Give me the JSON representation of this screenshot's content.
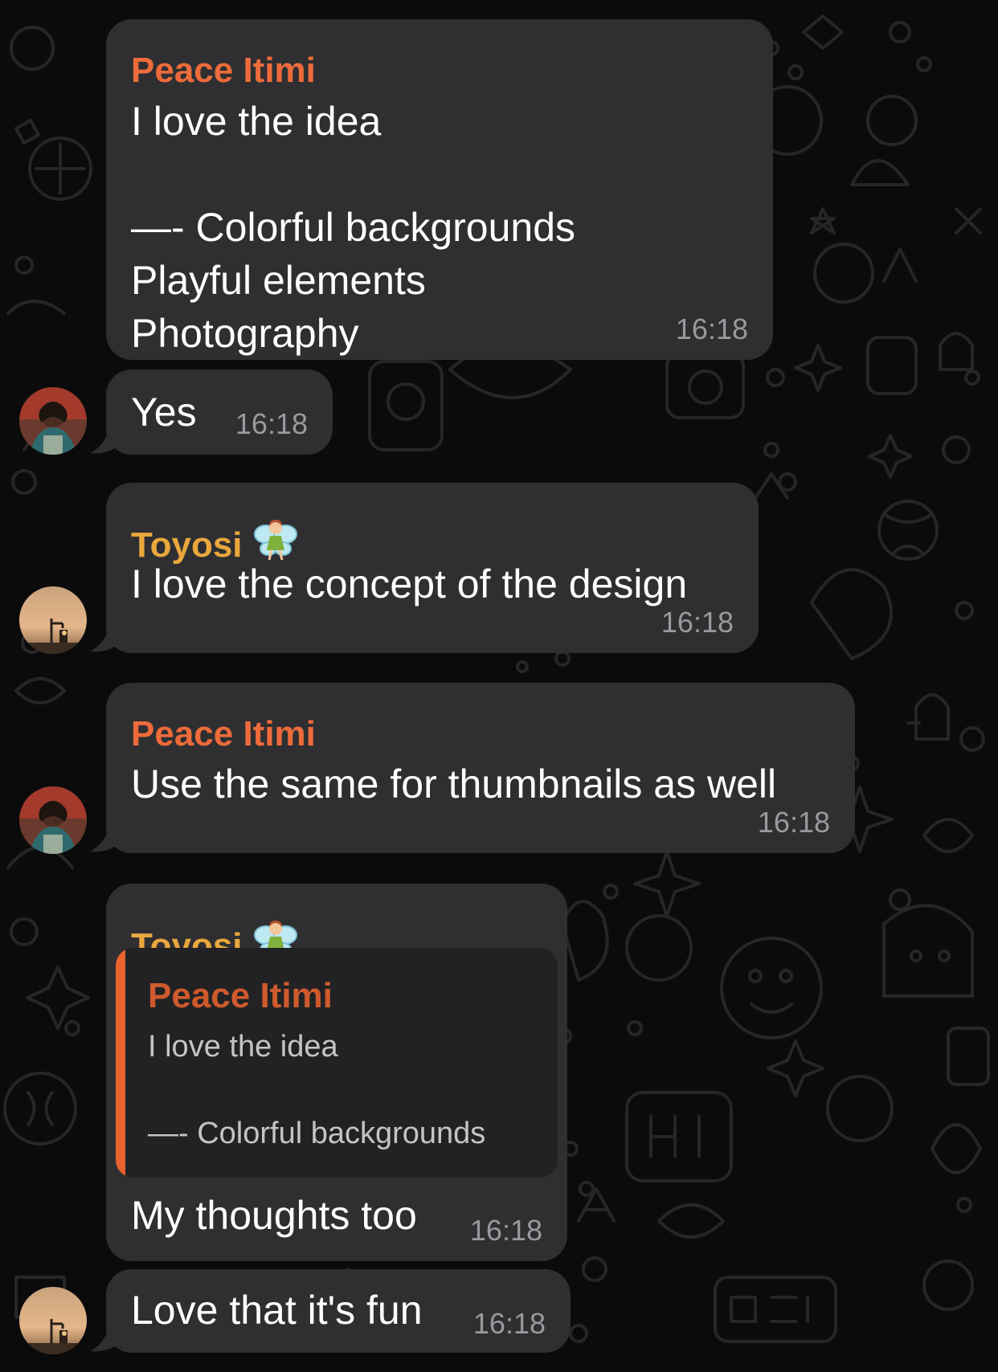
{
  "colors": {
    "background": "#0b0b0c",
    "bubble": "#2f2f31",
    "peace_name": "#ed6b3a",
    "toyosi_name": "#e9a73d",
    "quote_bar": "#e8622f",
    "timestamp": "#9a9a9e"
  },
  "messages": [
    {
      "sender": "Peace Itimi",
      "text": "I love the idea\n\n—- Colorful backgrounds\nPlayful elements\nPhotography",
      "time": "16:18"
    },
    {
      "text": "Yes",
      "time": "16:18",
      "avatar_icon": "peace-avatar-icon"
    },
    {
      "sender": "Toyosi",
      "sender_emoji": "fairy-emoji-icon",
      "text": "I love the concept of the design",
      "time": "16:18",
      "avatar_icon": "toyosi-avatar-icon"
    },
    {
      "sender": "Peace Itimi",
      "text": "Use the same for thumbnails as well",
      "time": "16:18",
      "avatar_icon": "peace-avatar-icon"
    },
    {
      "sender": "Toyosi",
      "sender_emoji": "fairy-emoji-icon",
      "quote": {
        "sender": "Peace Itimi",
        "text": "I love the idea\n\n—- Colorful backgrounds"
      },
      "text": "My thoughts too",
      "time": "16:18"
    },
    {
      "text": "Love that it's fun",
      "time": "16:18",
      "avatar_icon": "toyosi-avatar-icon"
    }
  ]
}
